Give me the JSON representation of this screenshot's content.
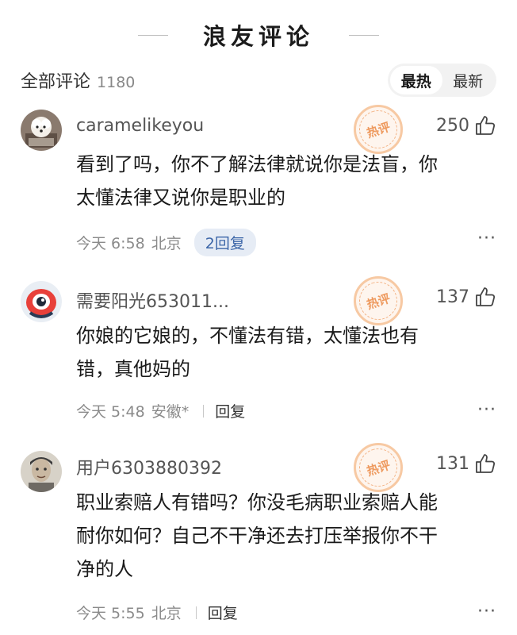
{
  "header": {
    "title": "浪友评论"
  },
  "subbar": {
    "all_label": "全部评论",
    "total": "1180",
    "sort_hot": "最热",
    "sort_new": "最新"
  },
  "hot_stamp_label": "热评",
  "more_label": "···",
  "comments": [
    {
      "username": "caramelikeyou",
      "likes": "250",
      "text_lines": [
        "看到了吗，你不了解法律就说你是法盲，你",
        "太懂法律又说你是职业的"
      ],
      "time": "今天 6:58",
      "location": "北京",
      "reply_label": "2回复"
    },
    {
      "username": "需要阳光653011...",
      "likes": "137",
      "text_lines": [
        "你娘的它娘的，不懂法有错，太懂法也有",
        "错，真他妈的"
      ],
      "time": "今天 5:48",
      "location": "安徽*",
      "reply_label": "回复"
    },
    {
      "username": "用户6303880392",
      "likes": "131",
      "text_lines": [
        "职业索赔人有错吗？你没毛病职业索赔人能",
        "耐你如何？自己不干净还去打压举报你不干",
        "净的人"
      ],
      "time": "今天 5:55",
      "location": "北京",
      "reply_label": "回复"
    }
  ]
}
